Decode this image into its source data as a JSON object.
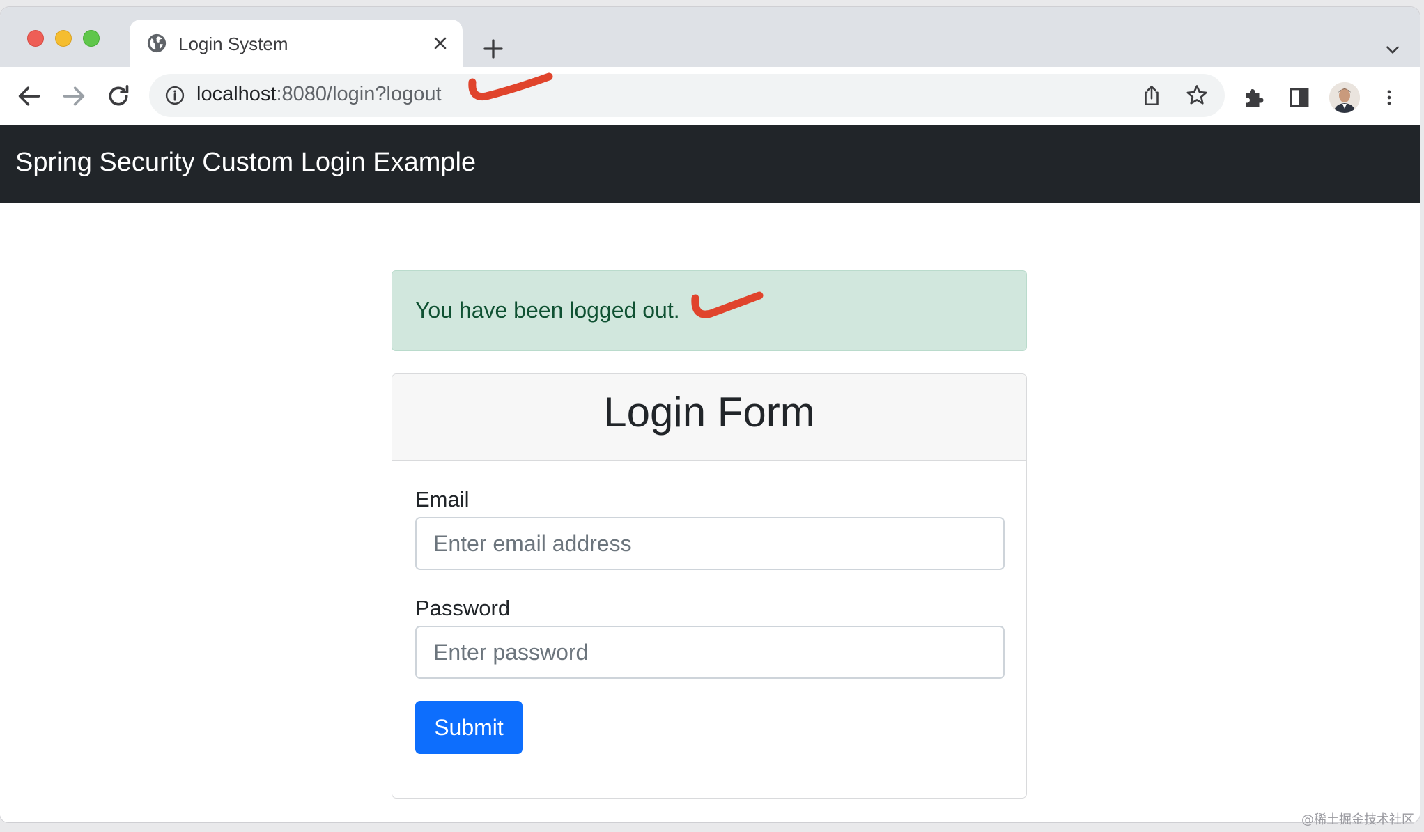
{
  "browser": {
    "tab_title": "Login System",
    "url_host": "localhost",
    "url_rest": ":8080/login?logout"
  },
  "icons": {
    "favicon": "globe-icon",
    "tab_close": "close-icon",
    "new_tab": "plus-icon",
    "tab_menu": "chevron-down-icon",
    "back": "arrow-left-icon",
    "forward": "arrow-right-icon",
    "reload": "reload-icon",
    "site_info": "info-icon",
    "share": "share-icon",
    "bookmark": "star-icon",
    "extensions": "puzzle-icon",
    "side_panel": "side-panel-icon",
    "profile": "avatar-icon",
    "more": "more-vertical-icon"
  },
  "navbar": {
    "brand": "Spring Security Custom Login Example"
  },
  "alert": {
    "message": "You have been logged out."
  },
  "login_form": {
    "title": "Login Form",
    "email_label": "Email",
    "email_placeholder": "Enter email address",
    "password_label": "Password",
    "password_placeholder": "Enter password",
    "submit_label": "Submit"
  },
  "watermark": "@稀土掘金技术社区",
  "colors": {
    "navbar_bg": "#212529",
    "alert_bg": "#d1e7dd",
    "alert_text": "#0f5132",
    "primary_button": "#0d6efd",
    "annotation_red": "#e0442c"
  }
}
